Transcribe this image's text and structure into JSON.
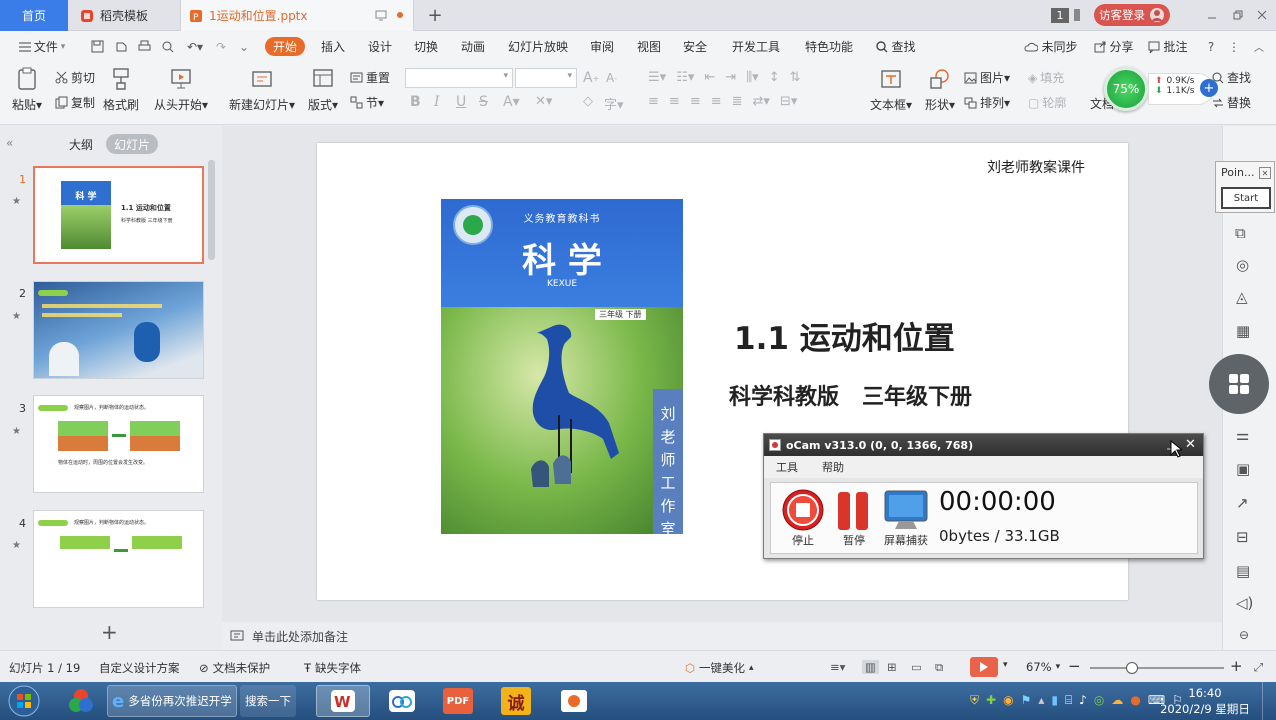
{
  "titlebar": {
    "home_tab": "首页",
    "template_tab": "稻壳模板",
    "file_tab": "1运动和位置.pptx",
    "add_tab": "+",
    "badge": "1",
    "login": "访客登录"
  },
  "menu": {
    "file": "文件",
    "items": [
      "开始",
      "插入",
      "设计",
      "切换",
      "动画",
      "幻灯片放映",
      "审阅",
      "视图",
      "安全",
      "开发工具",
      "特色功能"
    ],
    "search": "查找",
    "sync": "未同步",
    "share": "分享",
    "annotate": "批注"
  },
  "ribbon": {
    "paste": "粘贴",
    "cut": "剪切",
    "copy": "复制",
    "format_painter": "格式刷",
    "from_start": "从头开始",
    "new_slide": "新建幻灯片",
    "layout": "版式",
    "section": "节",
    "reset": "重置",
    "textbox": "文本框",
    "shape": "形状",
    "arrange": "排列",
    "picture": "图片",
    "fill": "填充",
    "outline": "轮廓",
    "find": "查找",
    "replace": "替换",
    "text_label": "文档",
    "net_percent": "75%",
    "net_up": "0.9K/s",
    "net_down": "1.1K/s"
  },
  "panel": {
    "outline_tab": "大纲",
    "slides_tab": "幻灯片",
    "slide_numbers": [
      "1",
      "2",
      "3",
      "4"
    ],
    "add_slide": "+"
  },
  "thumbs": {
    "t1_book": "科 学",
    "t1_title": "1.1 运动和位置",
    "t1_sub": "科学科教版   三年级下册",
    "t3_bar": "观察图片，判断物体的运动状态。",
    "t3_text": "物体在运动时，周围的位置会发生改变。",
    "t4_bar": "观察图片，判断物体的运动状态。"
  },
  "slide": {
    "top_right": "刘老师教案课件",
    "book_series": "义务教育教科书",
    "book_title": "科  学",
    "book_pinyin": "KEXUE",
    "book_grade": "三年级  下册",
    "side_text": "刘老师工作室",
    "title": "1.1 运动和位置",
    "subtitle": "科学科教版   三年级下册"
  },
  "notes": {
    "placeholder": "单击此处添加备注"
  },
  "ocam": {
    "title": "oCam v313.0 (0, 0, 1366, 768)",
    "menu_tools": "工具",
    "menu_help": "帮助",
    "stop": "停止",
    "pause": "暂停",
    "capture": "屏幕捕获",
    "timer": "00:00:00",
    "size": "0bytes / 33.1GB"
  },
  "popup": {
    "title": "Poin...",
    "button": "Start"
  },
  "status": {
    "slide_count": "幻灯片 1 / 19",
    "design": "自定义设计方案",
    "protect": "文档未保护",
    "font": "缺失字体",
    "beautify": "一键美化",
    "zoom": "67%"
  },
  "taskbar": {
    "ie_label": "多省份再次推迟开学",
    "search_label": "搜索一下",
    "pdf": "PDF",
    "cheng": "诚",
    "time": "16:40",
    "date": "2020/2/9 星期日"
  },
  "colors": {
    "accent": "#e96b2a",
    "home_tab": "#3a7ce8",
    "login": "#d9534f",
    "thumb_selected": "#e9775c",
    "book_blue": "#2f6fd0"
  }
}
